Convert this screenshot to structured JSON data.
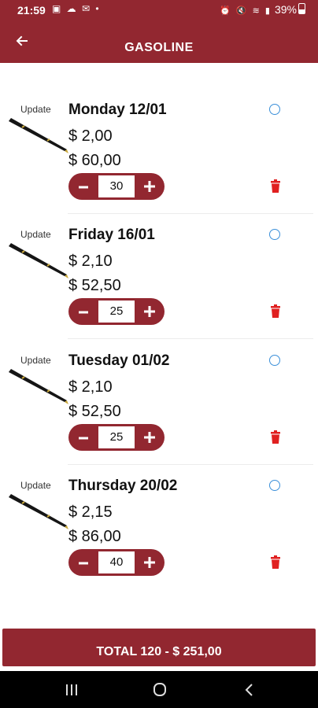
{
  "status_bar": {
    "time": "21:59",
    "notification_icons": "▣ ☁ ✉ •",
    "system_icons": "⏰ 🔇 ≋ ▮",
    "battery": "39%"
  },
  "header": {
    "title": "GASOLINE",
    "back_icon": "arrow-left-icon"
  },
  "update_label": "Update",
  "entries": [
    {
      "day": "Monday 12/01",
      "price": "$ 2,00",
      "total": "$ 60,00",
      "quantity": "30"
    },
    {
      "day": "Friday 16/01",
      "price": "$ 2,10",
      "total": "$ 52,50",
      "quantity": "25"
    },
    {
      "day": "Tuesday 01/02",
      "price": "$ 2,10",
      "total": "$ 52,50",
      "quantity": "25"
    },
    {
      "day": "Thursday 20/02",
      "price": "$ 2,15",
      "total": "$ 86,00",
      "quantity": "40"
    }
  ],
  "footer": {
    "total_label": "TOTAL 120 - $ 251,00"
  },
  "colors": {
    "primary": "#922730",
    "radio": "#3a8fd9",
    "delete": "#e02020"
  }
}
